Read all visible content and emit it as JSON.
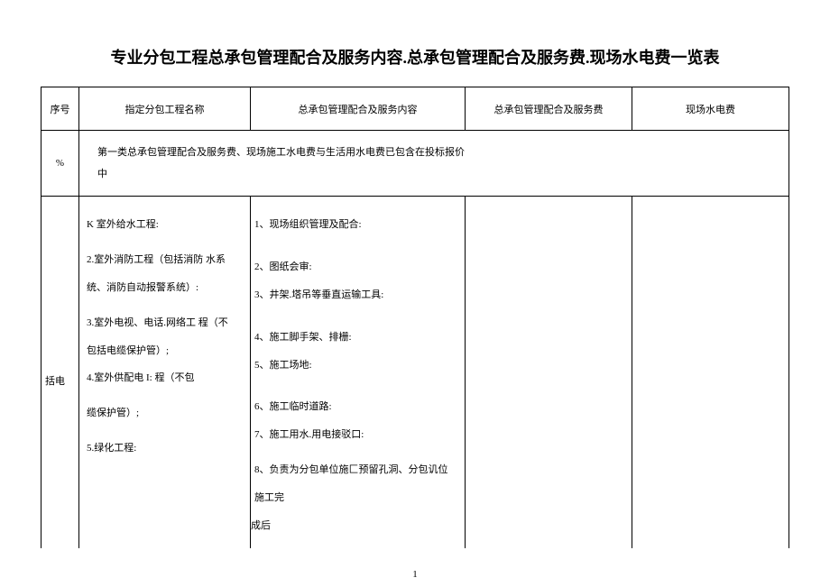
{
  "title": "专业分包工程总承包管理配合及服务内容.总承包管理配合及服务费.现场水电费一览表",
  "headers": {
    "col1": "序号",
    "col2": "指定分包工程名称",
    "col3": "总承包管理配合及服务内容",
    "col4": "总承包管理配合及服务费",
    "col5": "现场水电费"
  },
  "row_merged": {
    "pct": "%",
    "text_line1": "第一类总承包管理配合及服务费、现场施工水电费与生活用水电费已包含在投标报价",
    "text_line2": "中"
  },
  "row_data": {
    "col1_text": "括电",
    "col2_lines": [
      "K 室外给水工程:",
      "",
      "2.室外消防工程（包括消防 水系",
      "统、消防自动报警系统）:",
      "",
      "3.室外电视、电话.网络工 程（不",
      "包括电缆保护管）;",
      "4.室外供配电 I: 程（不包",
      "",
      "缆保护管）;",
      "",
      "5.绿化工程:"
    ],
    "col3_lines": [
      "1、现场组织管理及配合:",
      "",
      "",
      "2、图纸会审:",
      "3、井架.塔吊等垂直运输工具:",
      "",
      "",
      "4、施工脚手架、排栅:",
      "5、施工场地:",
      "",
      "",
      "6、施工临时道路:",
      "7、施工用水.用电接驳口:",
      "",
      "8、负责为分包单位施匚预留孔洞、分包讥位施工完",
      "成后"
    ]
  },
  "page_number": "1"
}
